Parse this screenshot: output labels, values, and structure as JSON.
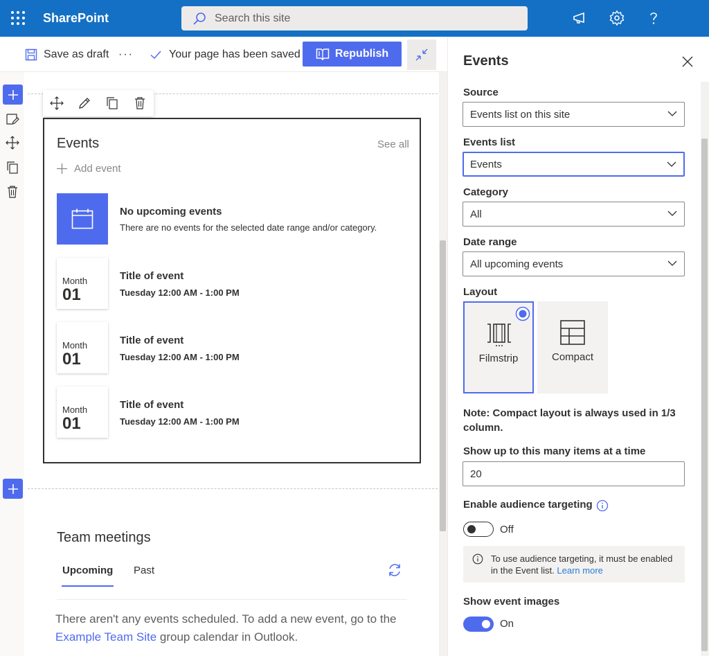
{
  "suitebar": {
    "brand": "SharePoint",
    "search_placeholder": "Search this site"
  },
  "commandbar": {
    "save_draft": "Save as draft",
    "more": "···",
    "saved_status": "Your page has been saved",
    "republish": "Republish"
  },
  "events_webpart": {
    "title": "Events",
    "see_all": "See all",
    "add_event": "Add event",
    "no_events_title": "No upcoming events",
    "no_events_sub": "There are no events for the selected date range and/or category.",
    "events": [
      {
        "month": "Month",
        "day": "01",
        "title": "Title of event",
        "time": "Tuesday 12:00 AM - 1:00 PM"
      },
      {
        "month": "Month",
        "day": "01",
        "title": "Title of event",
        "time": "Tuesday 12:00 AM - 1:00 PM"
      },
      {
        "month": "Month",
        "day": "01",
        "title": "Title of event",
        "time": "Tuesday 12:00 AM - 1:00 PM"
      }
    ]
  },
  "team_meetings": {
    "title": "Team meetings",
    "tabs": [
      "Upcoming",
      "Past"
    ],
    "message_before": "There aren't any events scheduled. To add a new event, go to the ",
    "link": "Example Team Site",
    "message_after": " group calendar in Outlook."
  },
  "pane": {
    "title": "Events",
    "source_label": "Source",
    "source_value": "Events list on this site",
    "events_list_label": "Events list",
    "events_list_value": "Events",
    "category_label": "Category",
    "category_value": "All",
    "date_range_label": "Date range",
    "date_range_value": "All upcoming events",
    "layout_label": "Layout",
    "layout_options": [
      "Filmstrip",
      "Compact"
    ],
    "note": "Note: Compact layout is always used in 1/3 column.",
    "items_label": "Show up to this many items at a time",
    "items_value": "20",
    "audience_label": "Enable audience targeting",
    "audience_state": "Off",
    "audience_info": "To use audience targeting, it must be enabled in the Event list.",
    "learn_more": "Learn more",
    "images_label": "Show event images",
    "images_state": "On"
  },
  "colors": {
    "suitebar": "#1470c4",
    "accent": "#4f6bed"
  }
}
